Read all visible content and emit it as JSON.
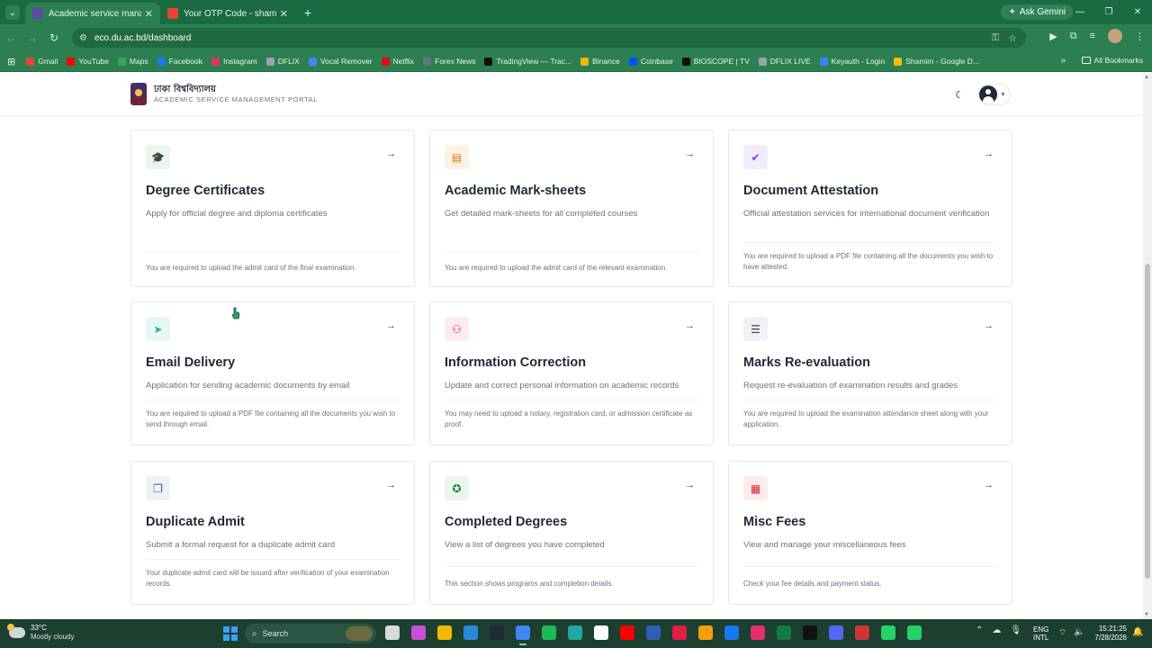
{
  "browser": {
    "tabs": [
      {
        "title": "Academic service management",
        "active": true,
        "favicon_color": "#5b4aa6"
      },
      {
        "title": "Your OTP Code - shamimalshah",
        "active": false,
        "favicon_color": "#ea4335"
      }
    ],
    "new_tab": "+",
    "ask_gemini": "Ask Gemini",
    "url": "eco.du.ac.bd/dashboard",
    "bookmarks": [
      {
        "label": "Gmail",
        "color": "#ea4335"
      },
      {
        "label": "YouTube",
        "color": "#ff0000"
      },
      {
        "label": "Maps",
        "color": "#34a853"
      },
      {
        "label": "Facebook",
        "color": "#1877f2"
      },
      {
        "label": "Instagram",
        "color": "#e1306c"
      },
      {
        "label": "DFLIX",
        "color": "#9ca3af"
      },
      {
        "label": "Vocal Remover",
        "color": "#4285f4"
      },
      {
        "label": "Netflix",
        "color": "#e50914"
      },
      {
        "label": "Forex News",
        "color": "#6b7280"
      },
      {
        "label": "TradingView — Trac...",
        "color": "#111111"
      },
      {
        "label": "Binance",
        "color": "#f0b90b"
      },
      {
        "label": "Coinbase",
        "color": "#0052ff"
      },
      {
        "label": "BIOSCOPE | TV",
        "color": "#111111"
      },
      {
        "label": "DFLIX LIVE",
        "color": "#9ca3af"
      },
      {
        "label": "Keyauth - Login",
        "color": "#3b82f6"
      },
      {
        "label": "Shamim - Google D...",
        "color": "#fbbc04"
      }
    ],
    "all_bookmarks": "All Bookmarks"
  },
  "site": {
    "brand_bn": "ঢাকা বিশ্ববিদ্যালয়",
    "brand_en": "ACADEMIC SERVICE MANAGEMENT PORTAL"
  },
  "cards": [
    {
      "title": "Degree Certificates",
      "desc": "Apply for official degree and diploma certificates",
      "note": "You are required to upload the admit card of the final examination.",
      "icon": "graduation-cap-icon",
      "glyph": "🎓",
      "icon_bg": "#e7f6ee",
      "icon_fg": "#16a34a"
    },
    {
      "title": "Academic Mark-sheets",
      "desc": "Get detailed mark-sheets for all completed courses",
      "note": "You are required to upload the admit card of the relevant examination.",
      "icon": "document-list-icon",
      "glyph": "▤",
      "icon_bg": "#fdf3e2",
      "icon_fg": "#d97706"
    },
    {
      "title": "Document Attestation",
      "desc": "Official attestation services for international document verification",
      "note": "You are required to upload a PDF file containing all the documents you wish to have attested.",
      "icon": "verified-badge-icon",
      "glyph": "✔",
      "icon_bg": "#f1ecfb",
      "icon_fg": "#7c3aed"
    },
    {
      "title": "Email Delivery",
      "desc": "Application for sending academic documents by email",
      "note": "You are required to upload a PDF file containing all the documents you wish to send through email.",
      "icon": "send-icon",
      "glyph": "➤",
      "icon_bg": "#e6f7f4",
      "icon_fg": "#14b8a6"
    },
    {
      "title": "Information Correction",
      "desc": "Update and correct personal information on academic records",
      "note": "You may need to upload a notary, registration card, or admission certificate as proof.",
      "icon": "user-edit-icon",
      "glyph": "⚇",
      "icon_bg": "#fcebf1",
      "icon_fg": "#db2777"
    },
    {
      "title": "Marks Re-evaluation",
      "desc": "Request re-evaluation of examination results and grades",
      "note": "You are required to upload the examination attendance sheet along with your application.",
      "icon": "checklist-icon",
      "glyph": "☰",
      "icon_bg": "#f1f2f5",
      "icon_fg": "#374151"
    },
    {
      "title": "Duplicate Admit",
      "desc": "Submit a formal request for a duplicate admit card",
      "note": "Your duplicate admit card will be issued after verification of your examination records.",
      "icon": "copy-icon",
      "glyph": "❐",
      "icon_bg": "#eef1f7",
      "icon_fg": "#4b5563"
    },
    {
      "title": "Completed Degrees",
      "desc": "View a list of degrees you have completed",
      "note": "This section shows programs and completion details.",
      "icon": "award-icon",
      "glyph": "✪",
      "icon_bg": "#e9f6ec",
      "icon_fg": "#15803d"
    },
    {
      "title": "Misc Fees",
      "desc": "View and manage your miscellaneous fees",
      "note": "Check your fee details and payment status.",
      "icon": "receipt-icon",
      "glyph": "▦",
      "icon_bg": "#fdecec",
      "icon_fg": "#dc2626"
    }
  ],
  "taskbar": {
    "temperature": "33°C",
    "condition": "Mostly cloudy",
    "search_placeholder": "Search",
    "lang_line1": "ENG",
    "lang_line2": "INTL",
    "time": "15:21:25",
    "date": "7/28/2026",
    "app_colors": [
      "#d9d9d9",
      "#c94fd6",
      "#f5b800",
      "#2b88d8",
      "#1f2937",
      "#4285f4",
      "#1db954",
      "#1fa8a0",
      "#ffffff",
      "#ff0000",
      "#2b5fb8",
      "#e11d48",
      "#f59e0b",
      "#1877f2",
      "#e1306c",
      "#107c41",
      "#111111",
      "#5865f2",
      "#d13438",
      "#25d366",
      "#25d366"
    ]
  }
}
